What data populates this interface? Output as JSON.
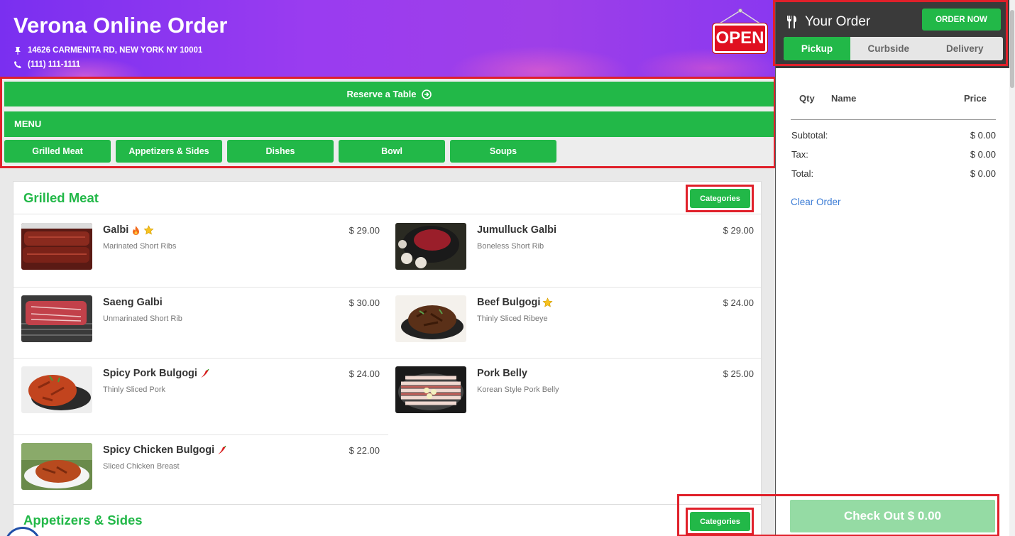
{
  "header": {
    "title": "Verona Online Order",
    "address": "14626 CARMENITA RD, NEW YORK NY 10001",
    "phone": "(111) 111-1111",
    "open_sign": "OPEN"
  },
  "nav": {
    "reserve_label": "Reserve a Table",
    "menu_label": "MENU",
    "categories": [
      "Grilled Meat",
      "Appetizers & Sides",
      "Dishes",
      "Bowl",
      "Soups"
    ]
  },
  "sections": [
    {
      "title": "Grilled Meat",
      "categories_button": "Categories",
      "items": [
        {
          "name": "Galbi",
          "desc": "Marinated Short Ribs",
          "price": "$ 29.00",
          "badges": [
            "fire-icon",
            "star-icon"
          ]
        },
        {
          "name": "Jumulluck Galbi",
          "desc": "Boneless Short Rib",
          "price": "$ 29.00",
          "badges": []
        },
        {
          "name": "Saeng Galbi",
          "desc": "Unmarinated Short Rib",
          "price": "$ 30.00",
          "badges": []
        },
        {
          "name": "Beef Bulgogi",
          "desc": "Thinly Sliced Ribeye",
          "price": "$ 24.00",
          "badges": [
            "star-icon"
          ]
        },
        {
          "name": "Spicy Pork Bulgogi",
          "desc": "Thinly Sliced Pork",
          "price": "$ 24.00",
          "badges": [
            "chili-icon"
          ]
        },
        {
          "name": "Pork Belly",
          "desc": "Korean Style Pork Belly",
          "price": "$ 25.00",
          "badges": []
        },
        {
          "name": "Spicy Chicken Bulgogi",
          "desc": "Sliced Chicken Breast",
          "price": "$ 22.00",
          "badges": [
            "chili-icon"
          ]
        }
      ]
    },
    {
      "title": "Appetizers & Sides",
      "categories_button": "Categories"
    }
  ],
  "order": {
    "title": "Your Order",
    "order_now": "ORDER NOW",
    "tabs": [
      "Pickup",
      "Curbside",
      "Delivery"
    ],
    "active_tab": "Pickup",
    "columns": {
      "qty": "Qty",
      "name": "Name",
      "price": "Price"
    },
    "subtotal_label": "Subtotal:",
    "subtotal": "$ 0.00",
    "tax_label": "Tax:",
    "tax": "$ 0.00",
    "total_label": "Total:",
    "total": "$ 0.00",
    "clear": "Clear Order",
    "checkout": "Check Out $ 0.00"
  },
  "colors": {
    "accent_green": "#22b848",
    "highlight_red": "#e0202a",
    "link_blue": "#3a7bd5",
    "header_purple": "#8a38f0"
  }
}
